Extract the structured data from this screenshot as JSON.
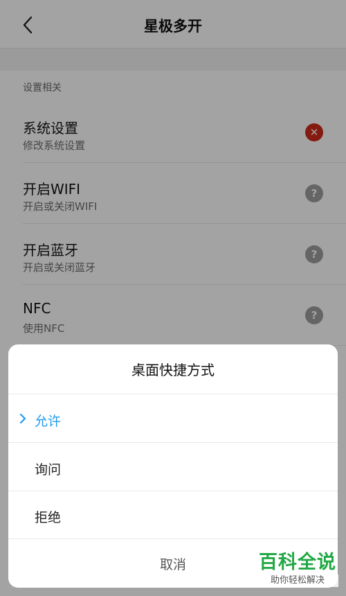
{
  "header": {
    "title": "星极多开",
    "back_icon": "chevron-left-icon"
  },
  "section": {
    "label": "设置相关"
  },
  "settings": [
    {
      "title": "系统设置",
      "subtitle": "修改系统设置",
      "status": "deny",
      "status_icon": "close-circle-icon",
      "status_color": "#d12a1a",
      "status_glyph": "✕"
    },
    {
      "title": "开启WIFI",
      "subtitle": "开启或关闭WIFI",
      "status": "ask",
      "status_icon": "question-circle-icon",
      "status_color": "#9e9e9e",
      "status_glyph": "?"
    },
    {
      "title": "开启蓝牙",
      "subtitle": "开启或关闭蓝牙",
      "status": "ask",
      "status_icon": "question-circle-icon",
      "status_color": "#9e9e9e",
      "status_glyph": "?"
    },
    {
      "title": "NFC",
      "subtitle": "使用NFC",
      "status": "ask",
      "status_icon": "question-circle-icon",
      "status_color": "#9e9e9e",
      "status_glyph": "?"
    }
  ],
  "dialog": {
    "title": "桌面快捷方式",
    "options": [
      {
        "label": "允许",
        "selected": true
      },
      {
        "label": "询问",
        "selected": false
      },
      {
        "label": "拒绝",
        "selected": false
      }
    ],
    "cancel_label": "取消",
    "accent_color": "#1e9bf0"
  },
  "watermark": {
    "main": "百科全说",
    "sub": "助你轻松解决"
  }
}
